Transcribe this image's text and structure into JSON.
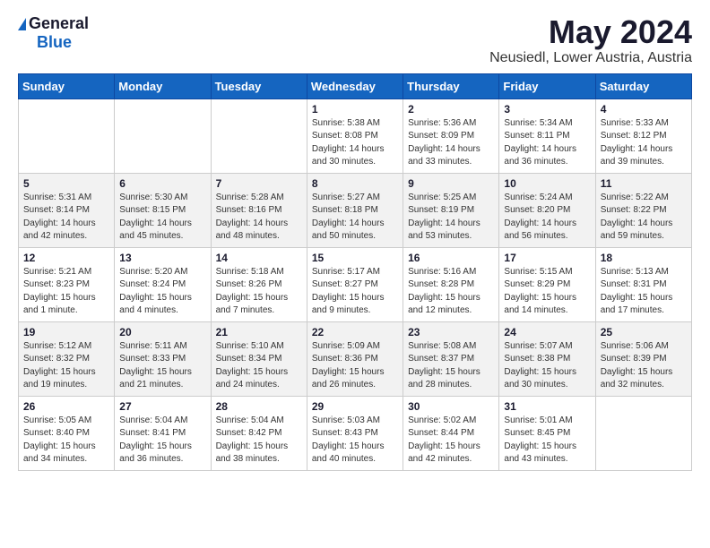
{
  "header": {
    "logo_general": "General",
    "logo_blue": "Blue",
    "month_title": "May 2024",
    "location": "Neusiedl, Lower Austria, Austria"
  },
  "days_of_week": [
    "Sunday",
    "Monday",
    "Tuesday",
    "Wednesday",
    "Thursday",
    "Friday",
    "Saturday"
  ],
  "weeks": [
    [
      {
        "day": "",
        "info": ""
      },
      {
        "day": "",
        "info": ""
      },
      {
        "day": "",
        "info": ""
      },
      {
        "day": "1",
        "info": "Sunrise: 5:38 AM\nSunset: 8:08 PM\nDaylight: 14 hours\nand 30 minutes."
      },
      {
        "day": "2",
        "info": "Sunrise: 5:36 AM\nSunset: 8:09 PM\nDaylight: 14 hours\nand 33 minutes."
      },
      {
        "day": "3",
        "info": "Sunrise: 5:34 AM\nSunset: 8:11 PM\nDaylight: 14 hours\nand 36 minutes."
      },
      {
        "day": "4",
        "info": "Sunrise: 5:33 AM\nSunset: 8:12 PM\nDaylight: 14 hours\nand 39 minutes."
      }
    ],
    [
      {
        "day": "5",
        "info": "Sunrise: 5:31 AM\nSunset: 8:14 PM\nDaylight: 14 hours\nand 42 minutes."
      },
      {
        "day": "6",
        "info": "Sunrise: 5:30 AM\nSunset: 8:15 PM\nDaylight: 14 hours\nand 45 minutes."
      },
      {
        "day": "7",
        "info": "Sunrise: 5:28 AM\nSunset: 8:16 PM\nDaylight: 14 hours\nand 48 minutes."
      },
      {
        "day": "8",
        "info": "Sunrise: 5:27 AM\nSunset: 8:18 PM\nDaylight: 14 hours\nand 50 minutes."
      },
      {
        "day": "9",
        "info": "Sunrise: 5:25 AM\nSunset: 8:19 PM\nDaylight: 14 hours\nand 53 minutes."
      },
      {
        "day": "10",
        "info": "Sunrise: 5:24 AM\nSunset: 8:20 PM\nDaylight: 14 hours\nand 56 minutes."
      },
      {
        "day": "11",
        "info": "Sunrise: 5:22 AM\nSunset: 8:22 PM\nDaylight: 14 hours\nand 59 minutes."
      }
    ],
    [
      {
        "day": "12",
        "info": "Sunrise: 5:21 AM\nSunset: 8:23 PM\nDaylight: 15 hours\nand 1 minute."
      },
      {
        "day": "13",
        "info": "Sunrise: 5:20 AM\nSunset: 8:24 PM\nDaylight: 15 hours\nand 4 minutes."
      },
      {
        "day": "14",
        "info": "Sunrise: 5:18 AM\nSunset: 8:26 PM\nDaylight: 15 hours\nand 7 minutes."
      },
      {
        "day": "15",
        "info": "Sunrise: 5:17 AM\nSunset: 8:27 PM\nDaylight: 15 hours\nand 9 minutes."
      },
      {
        "day": "16",
        "info": "Sunrise: 5:16 AM\nSunset: 8:28 PM\nDaylight: 15 hours\nand 12 minutes."
      },
      {
        "day": "17",
        "info": "Sunrise: 5:15 AM\nSunset: 8:29 PM\nDaylight: 15 hours\nand 14 minutes."
      },
      {
        "day": "18",
        "info": "Sunrise: 5:13 AM\nSunset: 8:31 PM\nDaylight: 15 hours\nand 17 minutes."
      }
    ],
    [
      {
        "day": "19",
        "info": "Sunrise: 5:12 AM\nSunset: 8:32 PM\nDaylight: 15 hours\nand 19 minutes."
      },
      {
        "day": "20",
        "info": "Sunrise: 5:11 AM\nSunset: 8:33 PM\nDaylight: 15 hours\nand 21 minutes."
      },
      {
        "day": "21",
        "info": "Sunrise: 5:10 AM\nSunset: 8:34 PM\nDaylight: 15 hours\nand 24 minutes."
      },
      {
        "day": "22",
        "info": "Sunrise: 5:09 AM\nSunset: 8:36 PM\nDaylight: 15 hours\nand 26 minutes."
      },
      {
        "day": "23",
        "info": "Sunrise: 5:08 AM\nSunset: 8:37 PM\nDaylight: 15 hours\nand 28 minutes."
      },
      {
        "day": "24",
        "info": "Sunrise: 5:07 AM\nSunset: 8:38 PM\nDaylight: 15 hours\nand 30 minutes."
      },
      {
        "day": "25",
        "info": "Sunrise: 5:06 AM\nSunset: 8:39 PM\nDaylight: 15 hours\nand 32 minutes."
      }
    ],
    [
      {
        "day": "26",
        "info": "Sunrise: 5:05 AM\nSunset: 8:40 PM\nDaylight: 15 hours\nand 34 minutes."
      },
      {
        "day": "27",
        "info": "Sunrise: 5:04 AM\nSunset: 8:41 PM\nDaylight: 15 hours\nand 36 minutes."
      },
      {
        "day": "28",
        "info": "Sunrise: 5:04 AM\nSunset: 8:42 PM\nDaylight: 15 hours\nand 38 minutes."
      },
      {
        "day": "29",
        "info": "Sunrise: 5:03 AM\nSunset: 8:43 PM\nDaylight: 15 hours\nand 40 minutes."
      },
      {
        "day": "30",
        "info": "Sunrise: 5:02 AM\nSunset: 8:44 PM\nDaylight: 15 hours\nand 42 minutes."
      },
      {
        "day": "31",
        "info": "Sunrise: 5:01 AM\nSunset: 8:45 PM\nDaylight: 15 hours\nand 43 minutes."
      },
      {
        "day": "",
        "info": ""
      }
    ]
  ]
}
